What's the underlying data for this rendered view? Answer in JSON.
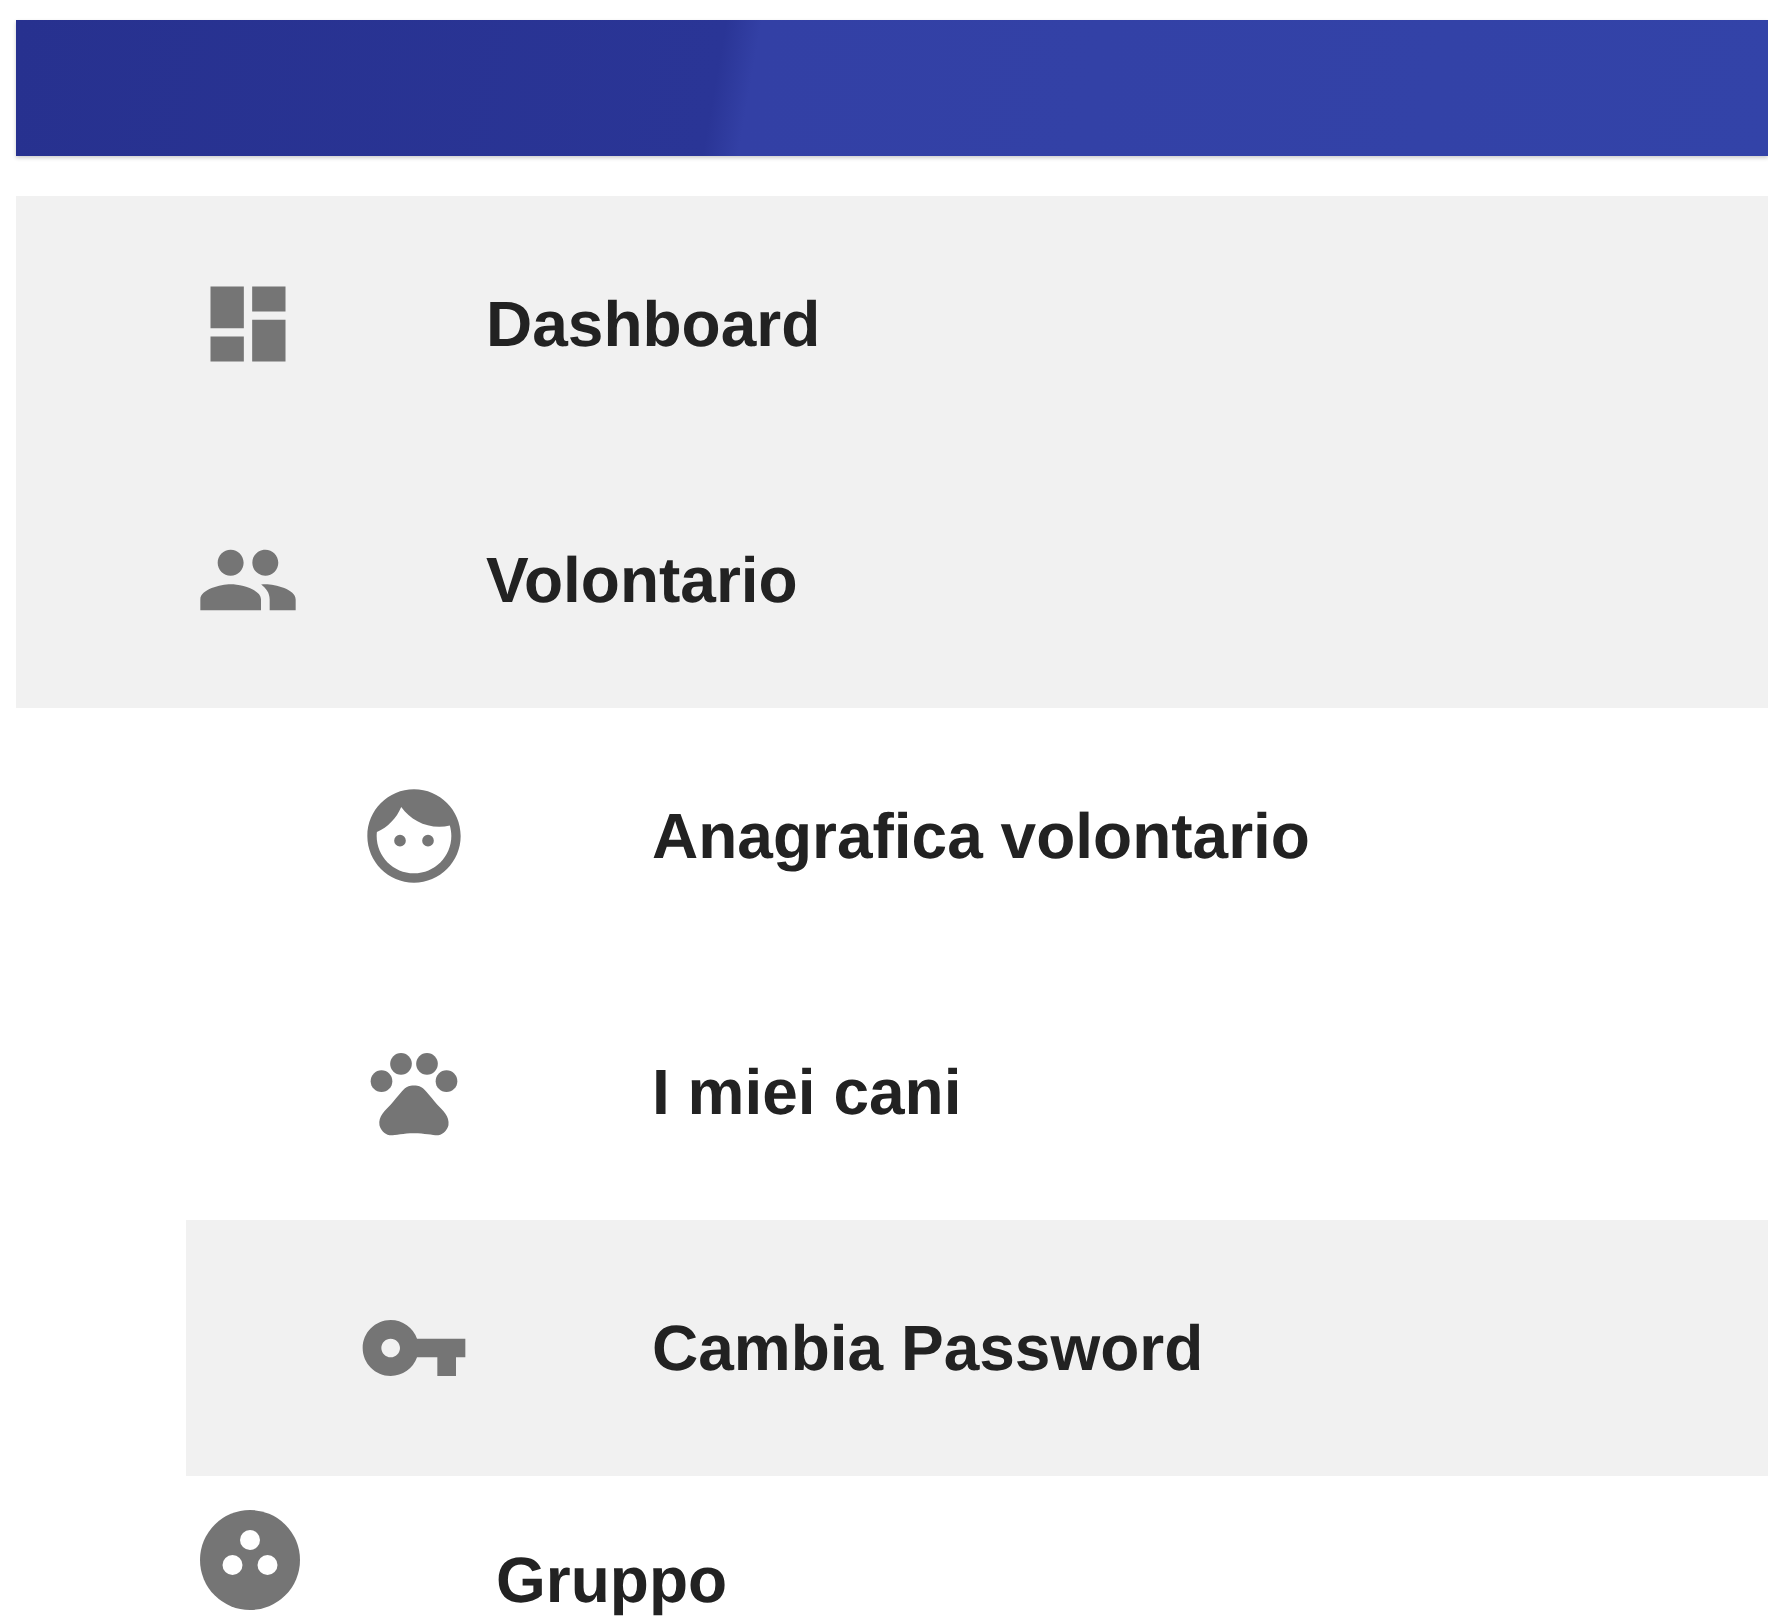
{
  "nav": {
    "items": [
      {
        "label": "Dashboard",
        "selected": true,
        "expanded": false
      },
      {
        "label": "Volontario",
        "selected": true,
        "expanded": true,
        "children": [
          {
            "label": "Anagrafica volontario",
            "selected": false
          },
          {
            "label": "I miei cani",
            "selected": false
          },
          {
            "label": "Cambia Password",
            "selected": true
          }
        ]
      },
      {
        "label": "Gruppo",
        "selected": false,
        "expanded": false
      }
    ]
  }
}
